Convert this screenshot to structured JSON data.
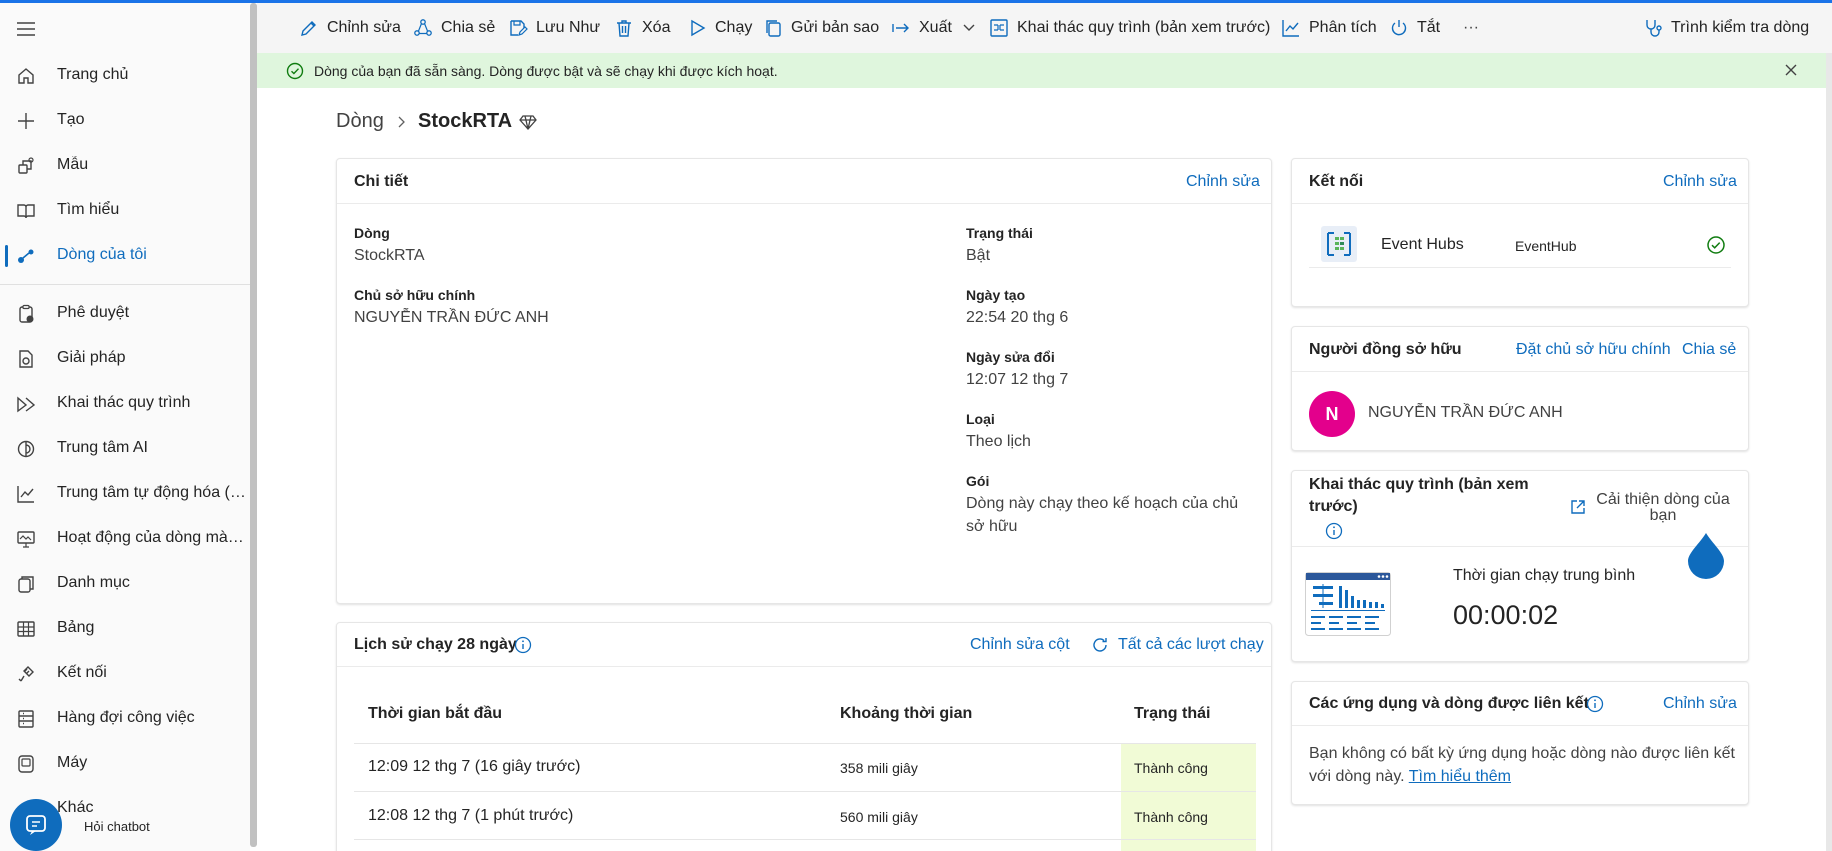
{
  "sidebar": {
    "items": [
      {
        "label": "Trang chủ",
        "icon": "home-icon"
      },
      {
        "label": "Tạo",
        "icon": "plus-icon"
      },
      {
        "label": "Mẫu",
        "icon": "template-icon"
      },
      {
        "label": "Tìm hiểu",
        "icon": "book-icon"
      },
      {
        "label": "Dòng của tôi",
        "icon": "flow-icon"
      },
      {
        "label": "Phê duyệt",
        "icon": "approval-icon"
      },
      {
        "label": "Giải pháp",
        "icon": "solution-icon"
      },
      {
        "label": "Khai thác quy trình",
        "icon": "process-mining-icon"
      },
      {
        "label": "Trung tâm AI",
        "icon": "ai-hub-icon"
      },
      {
        "label": "Trung tâm tự động hóa (b...",
        "icon": "chart-line-icon"
      },
      {
        "label": "Hoạt động của dòng màn ...",
        "icon": "monitor-icon"
      },
      {
        "label": "Danh mục",
        "icon": "catalog-icon"
      },
      {
        "label": "Bảng",
        "icon": "table-icon"
      },
      {
        "label": "Kết nối",
        "icon": "connection-icon"
      },
      {
        "label": "Hàng đợi công việc",
        "icon": "queue-icon"
      },
      {
        "label": "Máy",
        "icon": "machine-icon"
      },
      {
        "label": "Khác",
        "icon": "more-icon"
      }
    ],
    "chatbot_label": "Hỏi chatbot"
  },
  "toolbar": {
    "edit": "Chỉnh sửa",
    "share": "Chia sẻ",
    "save_as": "Lưu Như",
    "delete": "Xóa",
    "run": "Chạy",
    "send_copy": "Gửi bản sao",
    "export": "Xuất",
    "process_mining": "Khai thác quy trình (bản xem trước)",
    "analytics": "Phân tích",
    "turn_off": "Tắt",
    "more": "···",
    "checker": "Trình kiểm tra dòng"
  },
  "banner": {
    "message": "Dòng của bạn đã sẵn sàng. Dòng được bật và sẽ chạy khi được kích hoạt."
  },
  "breadcrumb": {
    "root": "Dòng",
    "current": "StockRTA"
  },
  "details": {
    "title": "Chi tiết",
    "edit_link": "Chỉnh sửa",
    "flow_label": "Dòng",
    "flow_value": "StockRTA",
    "owner_label": "Chủ sở hữu chính",
    "owner_value": "NGUYỄN TRẦN ĐỨC ANH",
    "status_label": "Trạng thái",
    "status_value": "Bật",
    "created_label": "Ngày tạo",
    "created_value": "22:54 20 thg 6",
    "modified_label": "Ngày sửa đổi",
    "modified_value": "12:07 12 thg 7",
    "type_label": "Loại",
    "type_value": "Theo lịch",
    "plan_label": "Gói",
    "plan_value": "Dòng này chạy theo kế hoạch của chủ sở hữu"
  },
  "history": {
    "title": "Lịch sử chạy 28 ngày",
    "edit_columns": "Chỉnh sửa cột",
    "all_runs": "Tất cả các lượt chạy",
    "columns": [
      "Thời gian bắt đầu",
      "Khoảng thời gian",
      "Trạng thái"
    ],
    "rows": [
      {
        "start": "12:09 12 thg 7 (16 giây trước)",
        "duration": "358 mili giây",
        "status": "Thành công"
      },
      {
        "start": "12:08 12 thg 7 (1 phút trước)",
        "duration": "560 mili giây",
        "status": "Thành công"
      }
    ]
  },
  "connections": {
    "title": "Kết nối",
    "edit_link": "Chỉnh sửa",
    "items": [
      {
        "name": "Event Hubs",
        "account": "EventHub"
      }
    ]
  },
  "co_owners": {
    "title": "Người đồng sở hữu",
    "set_owner": "Đặt chủ sở hữu chính",
    "share": "Chia sẻ",
    "avatar_initial": "N",
    "owner_name": "NGUYỄN TRẦN ĐỨC ANH",
    "avatar_color": "#e3008c"
  },
  "process_mining_card": {
    "title_line1": "Khai thác quy trình (bản xem",
    "title_line2": "trước)",
    "improve_line1": "Cải thiện dòng của",
    "improve_line2": "bạn",
    "avg_label": "Thời gian chạy trung bình",
    "avg_value": "00:00:02"
  },
  "linked_apps": {
    "title": "Các ứng dụng và dòng được liên kết",
    "edit_link": "Chỉnh sửa",
    "message_line1": "Bạn không có bất kỳ ứng dụng hoặc dòng nào được liên kết",
    "message_line2": "với dòng này.",
    "learn_more": "Tìm hiểu thêm"
  },
  "colors": {
    "accent": "#0f6cbd",
    "success_bg": "#dff6dd",
    "status_cell_bg": "#f1fbd6"
  }
}
